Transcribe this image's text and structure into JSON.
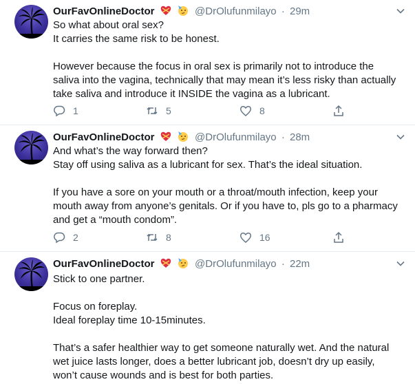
{
  "tweets": [
    {
      "display_name": "OurFavOnlineDoctor",
      "handle": "@DrOlufunmilayo",
      "dot": "·",
      "time": "29m",
      "lines": [
        "So what about oral sex?",
        "It carries the same risk to be honest.",
        "However because the focus in oral sex is primarily not to introduce the saliva into the vagina, technically that may mean it’s less risky than actually take saliva and introduce it INSIDE the vagina as a lubricant."
      ],
      "replies": "1",
      "retweets": "5",
      "likes": "8"
    },
    {
      "display_name": "OurFavOnlineDoctor",
      "handle": "@DrOlufunmilayo",
      "dot": "·",
      "time": "28m",
      "lines": [
        "And what’s the way forward then?",
        "Stay off using saliva as a lubricant for sex. That’s the ideal situation.",
        "If you have a sore on your mouth or a throat/mouth infection, keep your mouth away from anyone’s genitals. Or if you have to, pls go to a pharmacy and get a “mouth condom”."
      ],
      "replies": "2",
      "retweets": "8",
      "likes": "16"
    },
    {
      "display_name": "OurFavOnlineDoctor",
      "handle": "@DrOlufunmilayo",
      "dot": "·",
      "time": "22m",
      "lines": [
        "Stick to one partner.",
        "Focus on foreplay.",
        "Ideal foreplay time 10-15minutes.",
        "That’s a safer healthier way to get someone naturally wet. And the natural wet juice lasts longer, does a better lubricant job, doesn’t dry up easily, won’t cause wounds and is best for both parties."
      ]
    }
  ],
  "icons": {
    "emoji_1": "heart-with-ribbon-icon",
    "emoji_2": "partying-face-icon",
    "caret": "chevron-down-icon",
    "reply": "reply-icon",
    "retweet": "retweet-icon",
    "like": "heart-icon",
    "share": "share-icon"
  },
  "colors": {
    "secondary_text": "#657786",
    "separator": "#e6ecf0",
    "text": "#14171a"
  }
}
